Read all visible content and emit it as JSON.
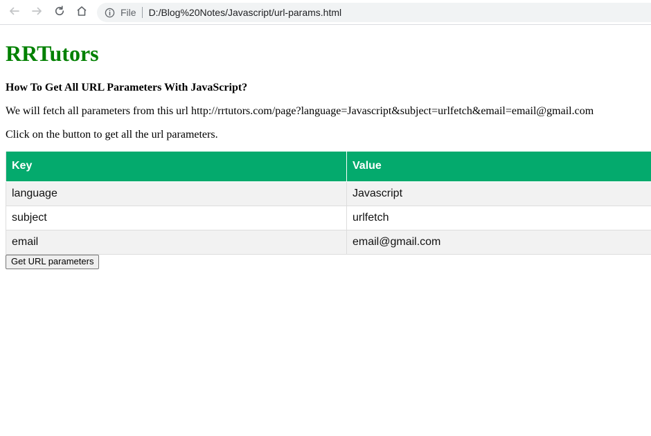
{
  "browser": {
    "scheme_label": "File",
    "url": "D:/Blog%20Notes/Javascript/url-params.html",
    "icons": {
      "back": "arrow-left-icon",
      "forward": "arrow-right-icon",
      "reload": "reload-icon",
      "home": "home-icon",
      "info": "info-icon"
    }
  },
  "page": {
    "title": "RRTutors",
    "heading": "How To Get All URL Parameters With JavaScript?",
    "description": "We will fetch all parameters from this url http://rrtutors.com/page?language=Javascript&subject=urlfetch&email=email@gmail.com",
    "instruction": "Click on the button to get all the url parameters.",
    "button_label": "Get URL parameters"
  },
  "table": {
    "headers": {
      "key": "Key",
      "value": "Value"
    },
    "rows": [
      {
        "key": "language",
        "value": "Javascript"
      },
      {
        "key": "subject",
        "value": "urlfetch"
      },
      {
        "key": "email",
        "value": "email@gmail.com"
      }
    ]
  },
  "colors": {
    "title": "#008000",
    "table_header": "#04AA6D",
    "striped_row": "#F2F2F2"
  }
}
